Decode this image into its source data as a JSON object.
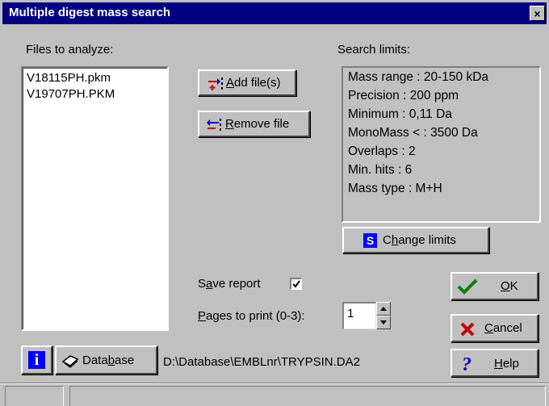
{
  "window": {
    "title": "Multiple digest mass search",
    "close_label": "×"
  },
  "files": {
    "label": "Files to analyze:",
    "items": [
      "V18115PH.pkm",
      "V19707PH.PKM"
    ],
    "add_button": {
      "pre": "",
      "u": "A",
      "post": "dd file(s)"
    },
    "remove_button": {
      "pre": "",
      "u": "R",
      "post": "emove file"
    }
  },
  "limits": {
    "label": "Search limits:",
    "lines": [
      "Mass range :  20-150 kDa",
      "Precision :   200 ppm",
      "Minimum   : 0,11 Da",
      "MonoMass < : 3500 Da",
      "Overlaps  : 2",
      "Min. hits :  6",
      "Mass type : M+H"
    ],
    "change_button": {
      "icon_letter": "S",
      "pre": "C",
      "u": "h",
      "post": "ange limits"
    }
  },
  "options": {
    "save_report": {
      "pre": "S",
      "u": "a",
      "post": "ve report",
      "checked": true
    },
    "pages": {
      "pre": "",
      "u": "P",
      "post": "ages to print (0-3):",
      "value": "1"
    }
  },
  "actions": {
    "ok": {
      "pre": "",
      "u": "O",
      "post": "K"
    },
    "cancel": {
      "pre": "",
      "u": "C",
      "post": "ancel"
    },
    "help": {
      "pre": "",
      "u": "H",
      "post": "elp"
    }
  },
  "database": {
    "info_letter": "i",
    "button": {
      "pre": "Data",
      "u": "b",
      "post": "ase"
    },
    "path": "D:\\Database\\EMBLnr\\TRYPSIN.DA2"
  },
  "colors": {
    "title_bar": "#000080",
    "face": "#c0c0c0",
    "ok_check": "#008000",
    "cancel_x": "#c00000",
    "help_q": "#0000c0",
    "blue_icon": "#0000ff"
  },
  "icons": {
    "close": "close-icon",
    "add": "add-file-icon",
    "remove": "remove-file-icon",
    "change": "change-limits-icon",
    "ok": "checkmark-icon",
    "cancel": "x-icon",
    "help": "question-icon",
    "info": "info-icon",
    "database": "book-icon"
  }
}
